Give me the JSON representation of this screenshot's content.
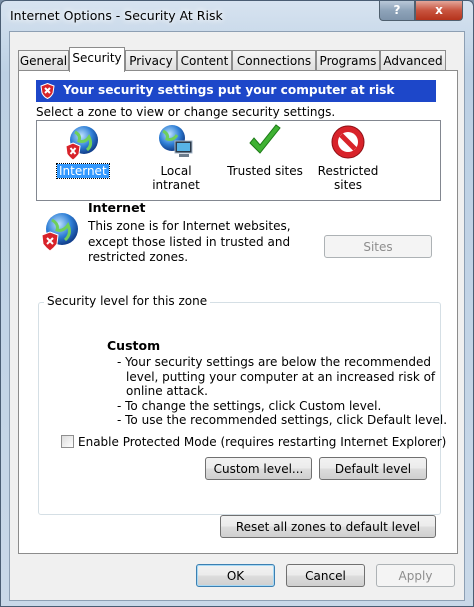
{
  "window": {
    "title": "Internet Options - Security At Risk",
    "help_label": "?",
    "close_label": "x"
  },
  "tabs": [
    {
      "label": "General",
      "active": false
    },
    {
      "label": "Security",
      "active": true
    },
    {
      "label": "Privacy",
      "active": false
    },
    {
      "label": "Content",
      "active": false
    },
    {
      "label": "Connections",
      "active": false
    },
    {
      "label": "Programs",
      "active": false
    },
    {
      "label": "Advanced",
      "active": false
    }
  ],
  "warning": {
    "text": "Your security settings put your computer at risk",
    "color": "#1d47c9"
  },
  "zones": {
    "prompt": "Select a zone to view or change security settings.",
    "items": [
      {
        "label": "Internet",
        "icon": "globe-warning-icon",
        "selected": true
      },
      {
        "label": "Local intranet",
        "icon": "globe-computer-icon",
        "selected": false
      },
      {
        "label": "Trusted sites",
        "icon": "checkmark-icon",
        "selected": false
      },
      {
        "label": "Restricted sites",
        "label_line1": "Restricted",
        "label_line2": "sites",
        "icon": "no-entry-icon",
        "selected": false
      }
    ]
  },
  "zone_info": {
    "title": "Internet",
    "description": "This zone is for Internet websites, except those listed in trusted and restricted zones.",
    "sites_button": "Sites"
  },
  "security_level": {
    "legend": "Security level for this zone",
    "level_name": "Custom",
    "lines": [
      "- Your security settings are below the recommended",
      "level, putting your computer at an increased risk of",
      "online attack.",
      "- To change the settings, click Custom level.",
      "- To use the recommended settings, click Default level."
    ],
    "protected_mode_label": "Enable Protected Mode (requires restarting Internet Explorer)",
    "protected_mode_checked": false,
    "custom_button": "Custom level...",
    "default_button": "Default level"
  },
  "reset_button": "Reset all zones to default level",
  "footer": {
    "ok": "OK",
    "cancel": "Cancel",
    "apply": "Apply"
  }
}
